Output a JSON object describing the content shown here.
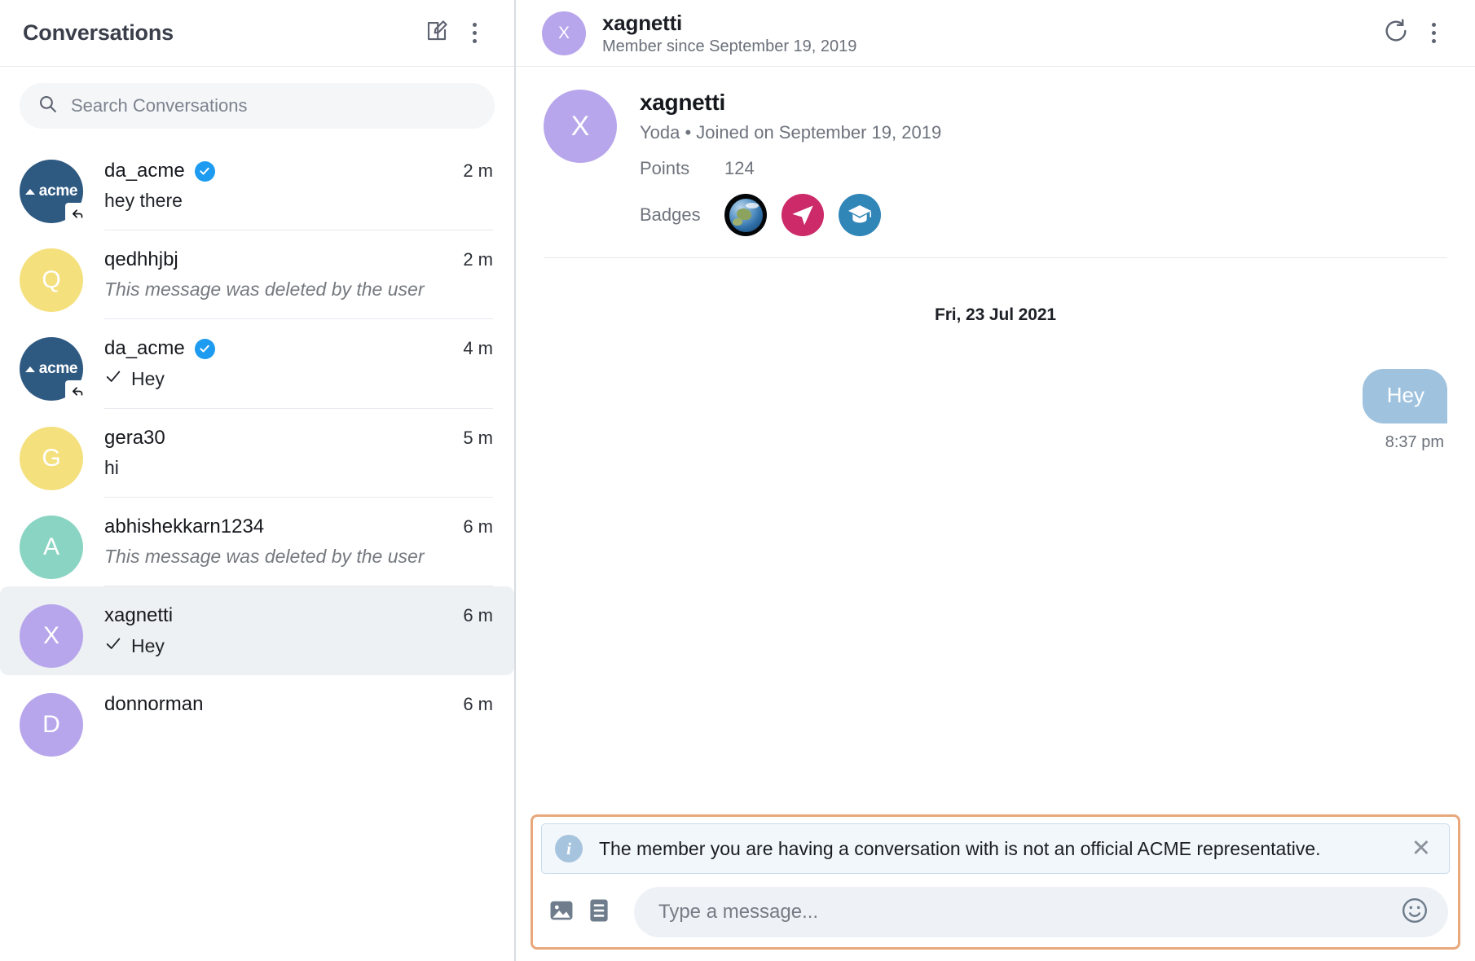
{
  "left": {
    "title": "Conversations",
    "compose_icon": "compose-icon",
    "menu_icon": "more-vertical-icon",
    "search": {
      "placeholder": "Search Conversations",
      "value": "",
      "icon": "search-icon"
    },
    "conversations": [
      {
        "name": "da_acme",
        "avatar_type": "acme-logo",
        "avatar_text": "acme",
        "avatar_color": "#2e5981",
        "verified": true,
        "reply_badge": true,
        "preview": "hey there",
        "preview_deleted": false,
        "sent_check": false,
        "time": "2 m",
        "selected": false
      },
      {
        "name": "qedhhjbj",
        "avatar_type": "letter",
        "avatar_text": "Q",
        "avatar_color": "#f5e07e",
        "verified": false,
        "reply_badge": false,
        "preview": "This message was deleted by the user",
        "preview_deleted": true,
        "sent_check": false,
        "time": "2 m",
        "selected": false
      },
      {
        "name": "da_acme",
        "avatar_type": "acme-logo",
        "avatar_text": "acme",
        "avatar_color": "#2e5981",
        "verified": true,
        "reply_badge": true,
        "preview": "Hey",
        "preview_deleted": false,
        "sent_check": true,
        "time": "4 m",
        "selected": false
      },
      {
        "name": "gera30",
        "avatar_type": "letter",
        "avatar_text": "G",
        "avatar_color": "#f5e07e",
        "verified": false,
        "reply_badge": false,
        "preview": "hi",
        "preview_deleted": false,
        "sent_check": false,
        "time": "5 m",
        "selected": false
      },
      {
        "name": "abhishekkarn1234",
        "avatar_type": "letter",
        "avatar_text": "A",
        "avatar_color": "#8ad4c3",
        "verified": false,
        "reply_badge": false,
        "preview": "This message was deleted by the user",
        "preview_deleted": true,
        "sent_check": false,
        "time": "6 m",
        "selected": false
      },
      {
        "name": "xagnetti",
        "avatar_type": "letter",
        "avatar_text": "X",
        "avatar_color": "#b8a6ec",
        "verified": false,
        "reply_badge": false,
        "preview": "Hey",
        "preview_deleted": false,
        "sent_check": true,
        "time": "6 m",
        "selected": true
      },
      {
        "name": "donnorman",
        "avatar_type": "letter",
        "avatar_text": "D",
        "avatar_color": "#b8a6ec",
        "verified": false,
        "reply_badge": false,
        "preview": "",
        "preview_deleted": false,
        "sent_check": false,
        "time": "6 m",
        "selected": false
      }
    ]
  },
  "right": {
    "header": {
      "avatar_text": "X",
      "name": "xagnetti",
      "subtitle": "Member since September 19, 2019",
      "refresh_icon": "refresh-icon",
      "menu_icon": "more-vertical-icon"
    },
    "profile": {
      "avatar_text": "X",
      "name": "xagnetti",
      "meta": "Yoda • Joined on September 19, 2019",
      "points_label": "Points",
      "points_value": "124",
      "badges_label": "Badges",
      "badges": [
        {
          "icon": "globe-badge-icon",
          "color": "#050608"
        },
        {
          "icon": "paper-plane-badge-icon",
          "color": "#cc2a69"
        },
        {
          "icon": "graduation-cap-badge-icon",
          "color": "#3186b8"
        }
      ]
    },
    "thread": {
      "date_separator": "Fri, 23 Jul 2021",
      "messages": [
        {
          "text": "Hey",
          "time": "8:37 pm",
          "direction": "outgoing",
          "bubble_color": "#9fc2de"
        }
      ]
    },
    "composer": {
      "notice": {
        "icon": "info-icon",
        "text": "The member you are having a conversation with is not an official ACME representative.",
        "close_icon": "close-icon"
      },
      "image_icon": "image-icon",
      "list_icon": "list-icon",
      "input": {
        "placeholder": "Type a message...",
        "value": ""
      },
      "emoji_icon": "emoji-smiley-icon",
      "highlight_color": "#e8a87c"
    }
  }
}
